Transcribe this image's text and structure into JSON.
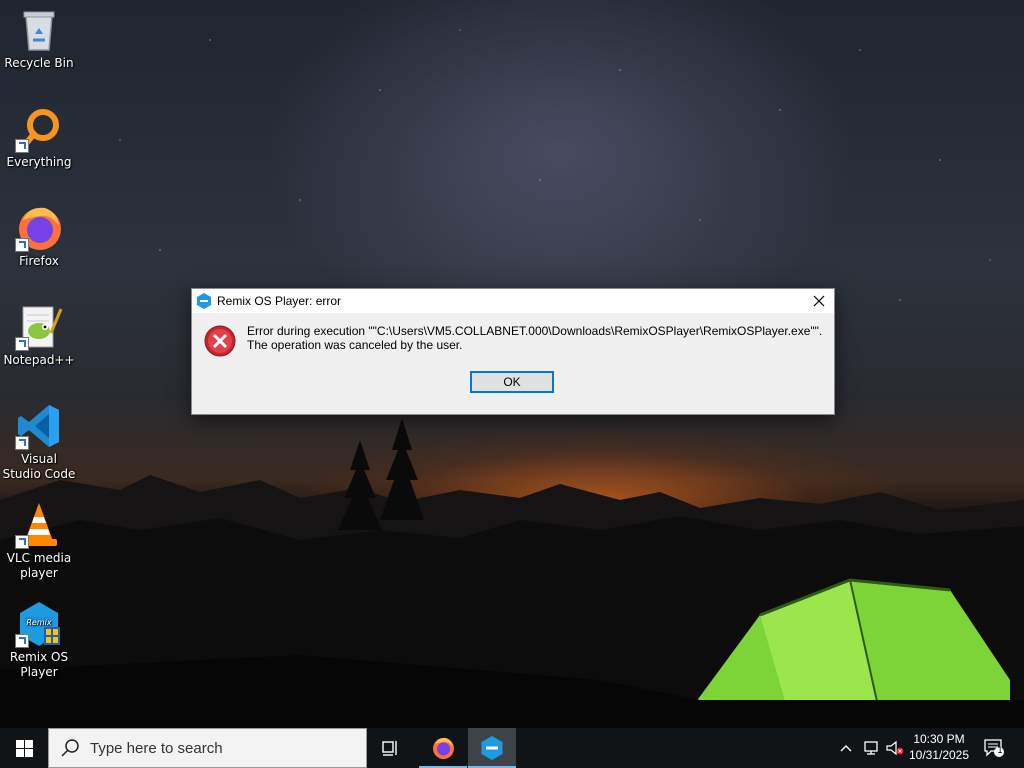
{
  "desktop": {
    "icons": [
      {
        "label": "Recycle Bin",
        "icon": "recycle-bin-icon"
      },
      {
        "label": "Everything",
        "icon": "everything-icon"
      },
      {
        "label": "Firefox",
        "icon": "firefox-icon"
      },
      {
        "label": "Notepad++",
        "icon": "notepadpp-icon"
      },
      {
        "label": "Visual Studio Code",
        "icon": "vscode-icon"
      },
      {
        "label": "VLC media player",
        "icon": "vlc-icon"
      },
      {
        "label": "Remix OS Player",
        "icon": "remix-os-icon"
      }
    ]
  },
  "dialog": {
    "title": "Remix OS Player: error",
    "message_line1": "Error during execution \"\"C:\\Users\\VM5.COLLABNET.000\\Downloads\\RemixOSPlayer\\RemixOSPlayer.exe\"\".",
    "message_line2": "The operation was canceled by the user.",
    "ok_label": "OK",
    "icon": "error-icon"
  },
  "taskbar": {
    "search_placeholder": "Type here to search",
    "pinned": [
      "task-view-icon",
      "firefox-icon",
      "remix-os-icon"
    ],
    "clock_time": "10:30 PM",
    "clock_date": "10/31/2025",
    "notification_count": "1"
  },
  "colors": {
    "accent": "#0078d7",
    "taskbar": "#101417",
    "dialog_bg": "#f0f0f0",
    "error_red": "#d13438"
  }
}
